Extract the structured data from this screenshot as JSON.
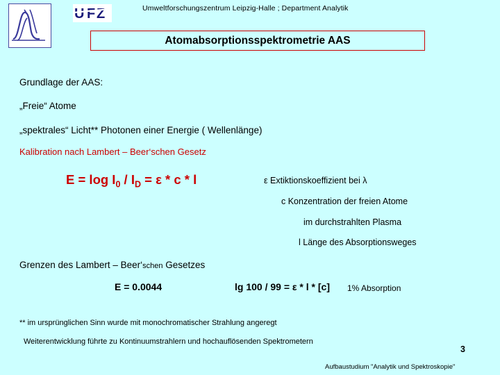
{
  "header": {
    "institution": "Umweltforschungszentrum Leipzig-Halle ; Department Analytik",
    "logo_alt": "ufz-logo",
    "wordmark": "UFZ"
  },
  "title": "Atomabsorptionsspektrometrie  AAS",
  "body": {
    "grundlage": "Grundlage der AAS:",
    "freie_atome": "„Freie“ Atome",
    "spektrales_licht": "„spektrales“ Licht**   Photonen einer Energie ( Wellenlänge)",
    "kalibration": "Kalibration nach Lambert – Beer‘schen Gesetz",
    "formula": {
      "prefix": "E = log I",
      "sub1": "0",
      "mid": " / I",
      "sub2": "D",
      "suffix": " =  ε * c  * l"
    },
    "explanations": [
      "ε  Extiktionskoeffizient bei λ",
      "c Konzentration der freien Atome",
      "im durchstrahlten Plasma",
      "l  Länge des Absorptionsweges"
    ],
    "grenzen_main": "Grenzen des Lambert – Beer‘",
    "grenzen_small": "schen",
    "grenzen_end": " Gesetzes",
    "example_e": "E = 0.0044",
    "example_lg": "lg 100 / 99 = ε * l * [c]",
    "example_abs": "1% Absorption",
    "footnote1": "** im ursprünglichen Sinn wurde mit monochromatischer Strahlung angeregt",
    "footnote2": "Weiterentwicklung führte zu Kontinuumstrahlern und hochauflösenden Spektrometern"
  },
  "footer": {
    "page_number": "3",
    "credit": "Aufbaustudium \"Analytik und Spektroskopie\""
  },
  "colors": {
    "background": "#ccffff",
    "accent_red": "#cc0000",
    "text": "#000000"
  }
}
